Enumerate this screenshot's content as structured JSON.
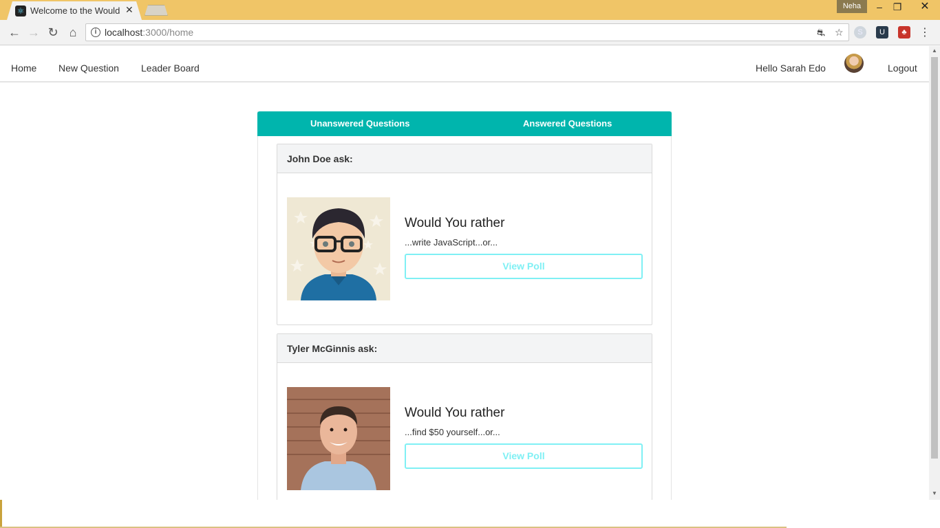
{
  "browser": {
    "tab_title": "Welcome to the Would Y",
    "tab_close": "✕",
    "profile_name": "Neha",
    "window_controls": {
      "minimize": "–",
      "maximize": "❐",
      "close": "✕"
    },
    "nav": {
      "back": "←",
      "forward": "→",
      "reload": "↻",
      "home": "⌂"
    },
    "url_host": "localhost",
    "url_path": ":3000/home",
    "info_glyph": "i",
    "translate_glyph": "⛐",
    "star_glyph": "☆",
    "ext_u_glyph": "U",
    "ext_red_glyph": "♣",
    "ext_skype_glyph": "S",
    "menu_glyph": "⋮"
  },
  "app_nav": {
    "links": [
      "Home",
      "New Question",
      "Leader Board"
    ],
    "greeting": "Hello Sarah Edo",
    "logout": "Logout"
  },
  "tabs": {
    "unanswered": "Unanswered Questions",
    "answered": "Answered Questions",
    "accent_color": "#00b5ad"
  },
  "questions": [
    {
      "asker": "John Doe ask:",
      "title": "Would You rather",
      "preview": "...write JavaScript...or...",
      "button": "View Poll"
    },
    {
      "asker": "Tyler McGinnis ask:",
      "title": "Would You rather",
      "preview": "...find $50 yourself...or...",
      "button": "View Poll"
    }
  ],
  "scrollbar": {
    "up": "▲",
    "down": "▼"
  }
}
